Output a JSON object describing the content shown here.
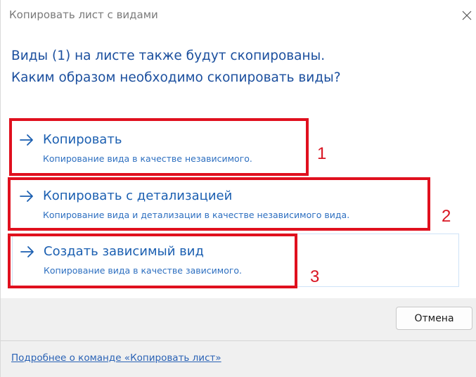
{
  "window": {
    "title": "Копировать лист с видами"
  },
  "instruction": {
    "line1": "Виды (1) на листе также будут скопированы.",
    "line2": "Каким образом необходимо скопировать виды?"
  },
  "options": [
    {
      "title": "Копировать",
      "description": "Копирование вида в качестве независимого.",
      "badge": "1"
    },
    {
      "title": "Копировать с детализацией",
      "description": "Копирование вида и детализации в качестве независимого вида.",
      "badge": "2"
    },
    {
      "title": "Создать зависимый вид",
      "description": "Копирование вида в качестве зависимого.",
      "badge": "3"
    }
  ],
  "buttons": {
    "cancel": "Отмена"
  },
  "footer": {
    "help_link": "Подробнее о команде «Копировать лист»"
  },
  "colors": {
    "accent": "#1b5fb1",
    "annotation": "#e0101e",
    "footer_background": "#f0f0f0"
  },
  "icons": {
    "close": "close-icon",
    "option_arrow": "arrow-right-icon"
  }
}
